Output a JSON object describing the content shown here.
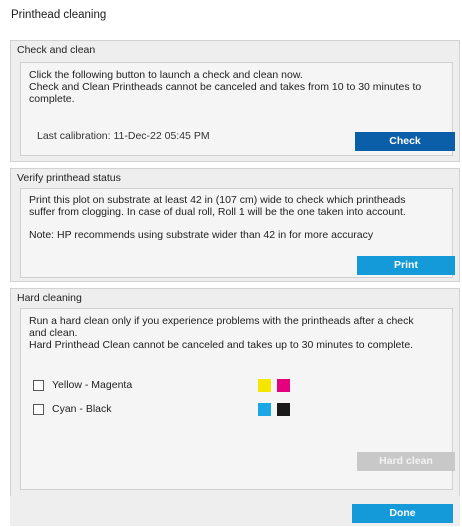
{
  "window": {
    "title": "Printhead cleaning"
  },
  "check_clean": {
    "title": "Check and clean",
    "line1": "Click the following button to launch a check and clean now.",
    "line2": "Check and Clean Printheads cannot be canceled and takes from 10 to 30 minutes to",
    "line3": "complete.",
    "last_calibration": "Last calibration: 11-Dec-22 05:45 PM",
    "button": "Check"
  },
  "verify": {
    "title": "Verify printhead status",
    "line1": "Print this plot on substrate at least 42 in (107 cm) wide to check which printheads",
    "line2": "suffer from clogging. In case of dual roll, Roll 1 will be the one taken into account.",
    "note": "Note: HP recommends using substrate wider than 42 in for more accuracy",
    "button": "Print"
  },
  "hard": {
    "title": "Hard cleaning",
    "line1": "Run a hard clean only if you experience problems with the printheads after a check",
    "line2": "and clean.",
    "line3": "Hard Printhead Clean cannot be canceled and takes up to 30 minutes to complete.",
    "options": [
      {
        "label": "Yellow - Magenta",
        "checked": false,
        "colors": [
          "#f5e600",
          "#e5007e"
        ]
      },
      {
        "label": "Cyan - Black",
        "checked": false,
        "colors": [
          "#1aa7e3",
          "#1a1a1a"
        ]
      }
    ],
    "button": "Hard clean"
  },
  "footer": {
    "button": "Done"
  }
}
